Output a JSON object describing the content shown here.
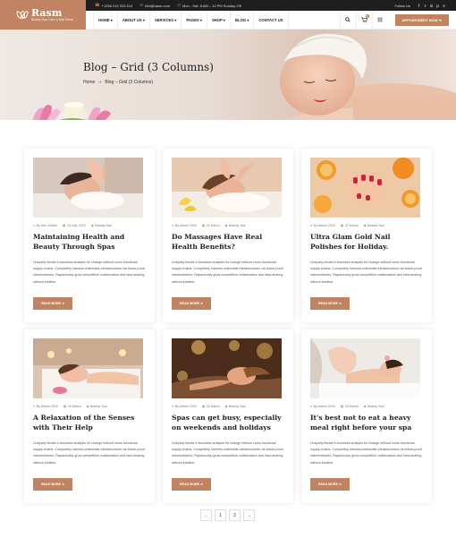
{
  "brand": {
    "name": "Rasm",
    "tagline": "Beauty Spa Care & Nail Salon",
    "accent": "#c08463"
  },
  "topbar": {
    "phone": "+1256 214 203 215",
    "email": "info@rasm.com",
    "hours": "Mon - Sat: 8 AM – 10 PM Sunday Off",
    "follow_label": "Follow Us"
  },
  "nav": {
    "items": [
      "HOME ▾",
      "ABOUT US ▾",
      "SERVICES ▾",
      "PAGES ▾",
      "SHOP ▾",
      "BLOG ▾",
      "CONTACT US"
    ],
    "cart_count": "0",
    "cta": "APPOINTMENT NOW ➔"
  },
  "hero": {
    "title": "Blog – Grid (3 Columns)",
    "crumb_home": "Home",
    "crumb_sep": "➔",
    "crumb_current": "Blog – Grid (3 Columns)"
  },
  "excerpt_text": "Uniquely iterate e-business analysis for change without cross functional supply chains. Completely harness extensible infrastructures via future-proof intermediaries. Rapaciously grow competitive collaboration and idea-sharing without intuitive.",
  "posts": [
    {
      "author": "By Alex Walter",
      "date": "15 July, 2023",
      "category": "Beauty Spa",
      "title": "Maintaining Health and Beauty Through Spas",
      "read_more": "READ MORE ➔"
    },
    {
      "author": "By Admin 2020",
      "date": "02 March",
      "category": "Beauty Spa",
      "title": "Do Massages Have Real Health Benefits?",
      "read_more": "READ MORE ➔"
    },
    {
      "author": "By Admin 2020",
      "date": "02 March",
      "category": "Beauty Spa",
      "title": "Ultra Glam Gold Nail Polishes for Holiday.",
      "read_more": "READ MORE ➔"
    },
    {
      "author": "By Admin 2020",
      "date": "02 March",
      "category": "Beauty Spa",
      "title": "A Relaxation of the Senses with Their Help",
      "read_more": "READ MORE ➔"
    },
    {
      "author": "By Admin 2020",
      "date": "02 March",
      "category": "Beauty Spa",
      "title": "Spas can get busy, especially on weekends and holidays",
      "read_more": "READ MORE ➔"
    },
    {
      "author": "By Admin 2020",
      "date": "02 March",
      "category": "Beauty Spa",
      "title": "It's best not to eat a heavy meal right before your spa",
      "read_more": "READ MORE ➔"
    }
  ],
  "pagination": {
    "prev": "←",
    "pages": [
      "1",
      "2"
    ],
    "next": "→"
  }
}
